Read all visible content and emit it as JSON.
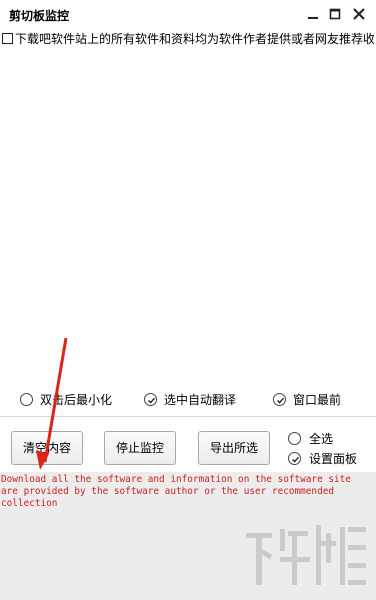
{
  "window": {
    "title": "剪切板监控",
    "controls": {
      "minimize_icon": "minimize-icon",
      "maximize_icon": "maximize-icon",
      "close_icon": "close-icon"
    }
  },
  "list": {
    "items": [
      {
        "text": "下载吧软件站上的所有软件和资料均为软件作者提供或者网友推荐收",
        "checked": false
      }
    ]
  },
  "options": {
    "minimize_on_double_click": {
      "label": "双击后最小化",
      "checked": false
    },
    "auto_translate_on_select": {
      "label": "选中自动翻译",
      "checked": true
    },
    "window_on_top": {
      "label": "窗口最前",
      "checked": true
    }
  },
  "buttons": {
    "clear": "清空内容",
    "stop": "停止监控",
    "export": "导出所选"
  },
  "right_checks": {
    "select_all": {
      "label": "全选",
      "checked": false
    },
    "settings_panel": {
      "label": "设置面板",
      "checked": true
    }
  },
  "output": {
    "text": "Download all the software and information on the software site\nare provided by the software author or the user recommended\ncollection"
  },
  "colors": {
    "output_text": "#cc1f1f",
    "annotation_arrow": "#d9261c",
    "output_bg": "#ececec"
  }
}
